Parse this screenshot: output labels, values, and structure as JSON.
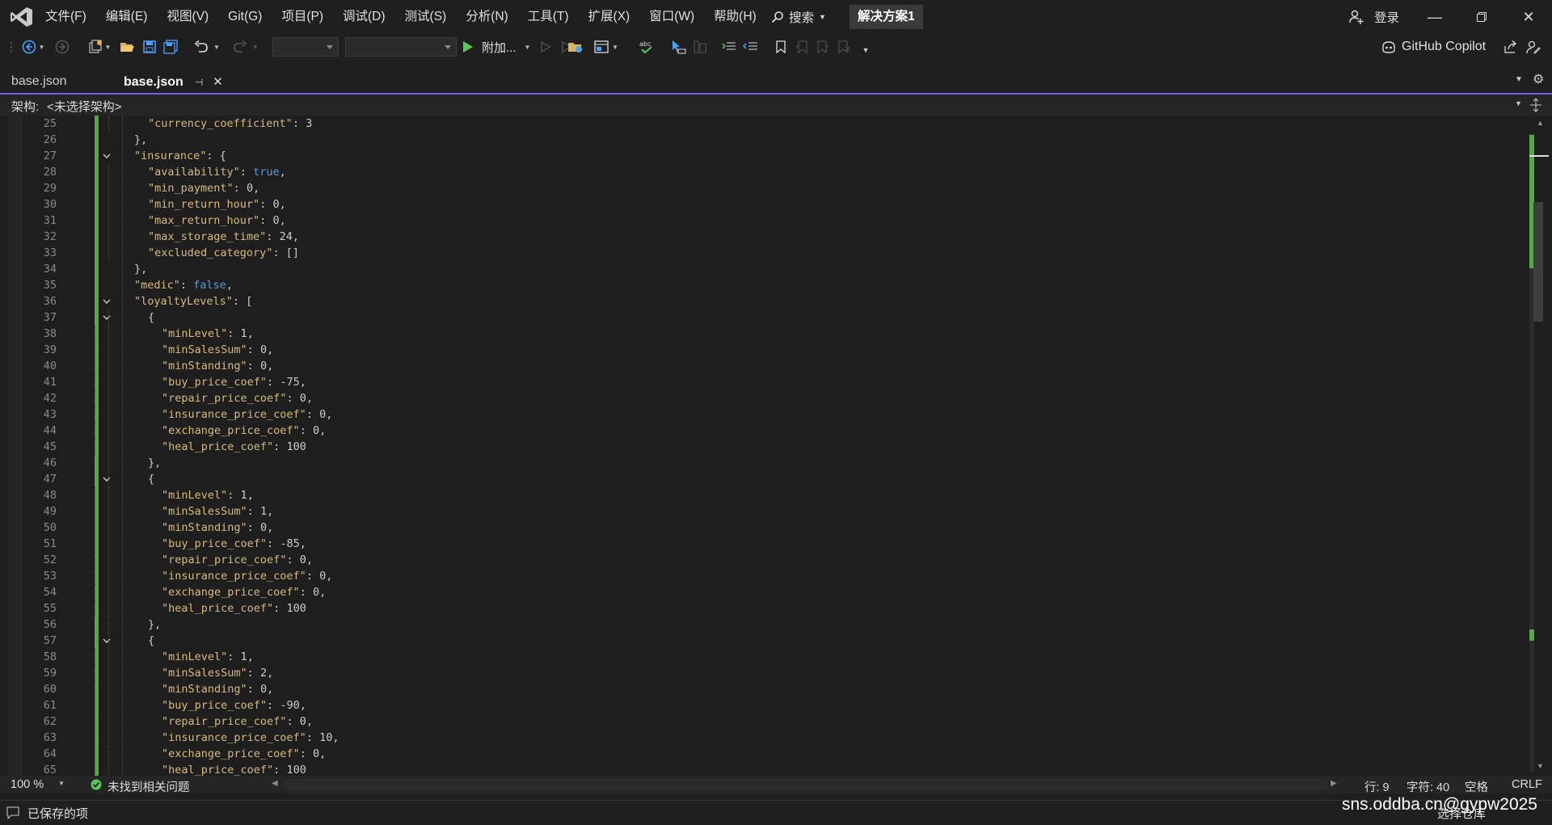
{
  "menu": {
    "items": [
      "文件(F)",
      "编辑(E)",
      "视图(V)",
      "Git(G)",
      "项目(P)",
      "调试(D)",
      "测试(S)",
      "分析(N)",
      "工具(T)",
      "扩展(X)",
      "窗口(W)",
      "帮助(H)"
    ],
    "search_label": "搜索",
    "solution_name": "解决方案1",
    "login_label": "登录"
  },
  "toolbar": {
    "attach_label": "附加...",
    "copilot_label": "GitHub Copilot"
  },
  "tabs": [
    {
      "label": "base.json",
      "active": false
    },
    {
      "label": "base.json",
      "active": true
    }
  ],
  "schema": {
    "label": "架构:",
    "value": "<未选择架构>"
  },
  "editor": {
    "lines": [
      {
        "n": 25,
        "indent": 2,
        "tokens": [
          [
            "k",
            "\"currency_coefficient\""
          ],
          [
            "p",
            ": "
          ],
          [
            "n",
            "3"
          ]
        ]
      },
      {
        "n": 26,
        "indent": 1,
        "tokens": [
          [
            "p",
            "},"
          ]
        ]
      },
      {
        "n": 27,
        "indent": 1,
        "fold": true,
        "tokens": [
          [
            "k",
            "\"insurance\""
          ],
          [
            "p",
            ": {"
          ]
        ]
      },
      {
        "n": 28,
        "indent": 2,
        "tokens": [
          [
            "k",
            "\"availability\""
          ],
          [
            "p",
            ": "
          ],
          [
            "kw",
            "true"
          ],
          [
            "p",
            ","
          ]
        ]
      },
      {
        "n": 29,
        "indent": 2,
        "tokens": [
          [
            "k",
            "\"min_payment\""
          ],
          [
            "p",
            ": "
          ],
          [
            "n",
            "0"
          ],
          [
            "p",
            ","
          ]
        ]
      },
      {
        "n": 30,
        "indent": 2,
        "tokens": [
          [
            "k",
            "\"min_return_hour\""
          ],
          [
            "p",
            ": "
          ],
          [
            "n",
            "0"
          ],
          [
            "p",
            ","
          ]
        ]
      },
      {
        "n": 31,
        "indent": 2,
        "tokens": [
          [
            "k",
            "\"max_return_hour\""
          ],
          [
            "p",
            ": "
          ],
          [
            "n",
            "0"
          ],
          [
            "p",
            ","
          ]
        ]
      },
      {
        "n": 32,
        "indent": 2,
        "tokens": [
          [
            "k",
            "\"max_storage_time\""
          ],
          [
            "p",
            ": "
          ],
          [
            "n",
            "24"
          ],
          [
            "p",
            ","
          ]
        ]
      },
      {
        "n": 33,
        "indent": 2,
        "tokens": [
          [
            "k",
            "\"excluded_category\""
          ],
          [
            "p",
            ": []"
          ]
        ]
      },
      {
        "n": 34,
        "indent": 1,
        "tokens": [
          [
            "p",
            "},"
          ]
        ]
      },
      {
        "n": 35,
        "indent": 1,
        "tokens": [
          [
            "k",
            "\"medic\""
          ],
          [
            "p",
            ": "
          ],
          [
            "kw",
            "false"
          ],
          [
            "p",
            ","
          ]
        ]
      },
      {
        "n": 36,
        "indent": 1,
        "fold": true,
        "tokens": [
          [
            "k",
            "\"loyaltyLevels\""
          ],
          [
            "p",
            ": ["
          ]
        ]
      },
      {
        "n": 37,
        "indent": 2,
        "fold": true,
        "tokens": [
          [
            "p",
            "{"
          ]
        ]
      },
      {
        "n": 38,
        "indent": 3,
        "tokens": [
          [
            "k",
            "\"minLevel\""
          ],
          [
            "p",
            ": "
          ],
          [
            "n",
            "1"
          ],
          [
            "p",
            ","
          ]
        ]
      },
      {
        "n": 39,
        "indent": 3,
        "tokens": [
          [
            "k",
            "\"minSalesSum\""
          ],
          [
            "p",
            ": "
          ],
          [
            "n",
            "0"
          ],
          [
            "p",
            ","
          ]
        ]
      },
      {
        "n": 40,
        "indent": 3,
        "tokens": [
          [
            "k",
            "\"minStanding\""
          ],
          [
            "p",
            ": "
          ],
          [
            "n",
            "0"
          ],
          [
            "p",
            ","
          ]
        ]
      },
      {
        "n": 41,
        "indent": 3,
        "tokens": [
          [
            "k",
            "\"buy_price_coef\""
          ],
          [
            "p",
            ": "
          ],
          [
            "n",
            "-75"
          ],
          [
            "p",
            ","
          ]
        ]
      },
      {
        "n": 42,
        "indent": 3,
        "tokens": [
          [
            "k",
            "\"repair_price_coef\""
          ],
          [
            "p",
            ": "
          ],
          [
            "n",
            "0"
          ],
          [
            "p",
            ","
          ]
        ]
      },
      {
        "n": 43,
        "indent": 3,
        "tokens": [
          [
            "k",
            "\"insurance_price_coef\""
          ],
          [
            "p",
            ": "
          ],
          [
            "n",
            "0"
          ],
          [
            "p",
            ","
          ]
        ]
      },
      {
        "n": 44,
        "indent": 3,
        "tokens": [
          [
            "k",
            "\"exchange_price_coef\""
          ],
          [
            "p",
            ": "
          ],
          [
            "n",
            "0"
          ],
          [
            "p",
            ","
          ]
        ]
      },
      {
        "n": 45,
        "indent": 3,
        "tokens": [
          [
            "k",
            "\"heal_price_coef\""
          ],
          [
            "p",
            ": "
          ],
          [
            "n",
            "100"
          ]
        ]
      },
      {
        "n": 46,
        "indent": 2,
        "tokens": [
          [
            "p",
            "},"
          ]
        ]
      },
      {
        "n": 47,
        "indent": 2,
        "fold": true,
        "tokens": [
          [
            "p",
            "{"
          ]
        ]
      },
      {
        "n": 48,
        "indent": 3,
        "tokens": [
          [
            "k",
            "\"minLevel\""
          ],
          [
            "p",
            ": "
          ],
          [
            "n",
            "1"
          ],
          [
            "p",
            ","
          ]
        ]
      },
      {
        "n": 49,
        "indent": 3,
        "tokens": [
          [
            "k",
            "\"minSalesSum\""
          ],
          [
            "p",
            ": "
          ],
          [
            "n",
            "1"
          ],
          [
            "p",
            ","
          ]
        ]
      },
      {
        "n": 50,
        "indent": 3,
        "tokens": [
          [
            "k",
            "\"minStanding\""
          ],
          [
            "p",
            ": "
          ],
          [
            "n",
            "0"
          ],
          [
            "p",
            ","
          ]
        ]
      },
      {
        "n": 51,
        "indent": 3,
        "tokens": [
          [
            "k",
            "\"buy_price_coef\""
          ],
          [
            "p",
            ": "
          ],
          [
            "n",
            "-85"
          ],
          [
            "p",
            ","
          ]
        ]
      },
      {
        "n": 52,
        "indent": 3,
        "tokens": [
          [
            "k",
            "\"repair_price_coef\""
          ],
          [
            "p",
            ": "
          ],
          [
            "n",
            "0"
          ],
          [
            "p",
            ","
          ]
        ]
      },
      {
        "n": 53,
        "indent": 3,
        "tokens": [
          [
            "k",
            "\"insurance_price_coef\""
          ],
          [
            "p",
            ": "
          ],
          [
            "n",
            "0"
          ],
          [
            "p",
            ","
          ]
        ]
      },
      {
        "n": 54,
        "indent": 3,
        "tokens": [
          [
            "k",
            "\"exchange_price_coef\""
          ],
          [
            "p",
            ": "
          ],
          [
            "n",
            "0"
          ],
          [
            "p",
            ","
          ]
        ]
      },
      {
        "n": 55,
        "indent": 3,
        "tokens": [
          [
            "k",
            "\"heal_price_coef\""
          ],
          [
            "p",
            ": "
          ],
          [
            "n",
            "100"
          ]
        ]
      },
      {
        "n": 56,
        "indent": 2,
        "tokens": [
          [
            "p",
            "},"
          ]
        ]
      },
      {
        "n": 57,
        "indent": 2,
        "fold": true,
        "tokens": [
          [
            "p",
            "{"
          ]
        ]
      },
      {
        "n": 58,
        "indent": 3,
        "tokens": [
          [
            "k",
            "\"minLevel\""
          ],
          [
            "p",
            ": "
          ],
          [
            "n",
            "1"
          ],
          [
            "p",
            ","
          ]
        ]
      },
      {
        "n": 59,
        "indent": 3,
        "tokens": [
          [
            "k",
            "\"minSalesSum\""
          ],
          [
            "p",
            ": "
          ],
          [
            "n",
            "2"
          ],
          [
            "p",
            ","
          ]
        ]
      },
      {
        "n": 60,
        "indent": 3,
        "tokens": [
          [
            "k",
            "\"minStanding\""
          ],
          [
            "p",
            ": "
          ],
          [
            "n",
            "0"
          ],
          [
            "p",
            ","
          ]
        ]
      },
      {
        "n": 61,
        "indent": 3,
        "tokens": [
          [
            "k",
            "\"buy_price_coef\""
          ],
          [
            "p",
            ": "
          ],
          [
            "n",
            "-90"
          ],
          [
            "p",
            ","
          ]
        ]
      },
      {
        "n": 62,
        "indent": 3,
        "tokens": [
          [
            "k",
            "\"repair_price_coef\""
          ],
          [
            "p",
            ": "
          ],
          [
            "n",
            "0"
          ],
          [
            "p",
            ","
          ]
        ]
      },
      {
        "n": 63,
        "indent": 3,
        "tokens": [
          [
            "k",
            "\"insurance_price_coef\""
          ],
          [
            "p",
            ": "
          ],
          [
            "n",
            "10"
          ],
          [
            "p",
            ","
          ]
        ]
      },
      {
        "n": 64,
        "indent": 3,
        "tokens": [
          [
            "k",
            "\"exchange_price_coef\""
          ],
          [
            "p",
            ": "
          ],
          [
            "n",
            "0"
          ],
          [
            "p",
            ","
          ]
        ]
      },
      {
        "n": 65,
        "indent": 3,
        "tokens": [
          [
            "k",
            "\"heal_price_coef\""
          ],
          [
            "p",
            ": "
          ],
          [
            "n",
            "100"
          ]
        ]
      }
    ]
  },
  "status": {
    "zoom": "100 %",
    "issues": "未找到相关问题",
    "line": "行: 9",
    "char": "字符: 40",
    "space": "空格",
    "eol": "CRLF"
  },
  "bottom": {
    "saved": "已保存的项",
    "select_repo": "选择仓库"
  },
  "watermark": "sns.oddba.cn@gypw2025",
  "colors": {
    "accent": "#7160e8",
    "change_bar": "#57a64a",
    "key": "#d7ba7d",
    "keyword": "#569cd6"
  }
}
